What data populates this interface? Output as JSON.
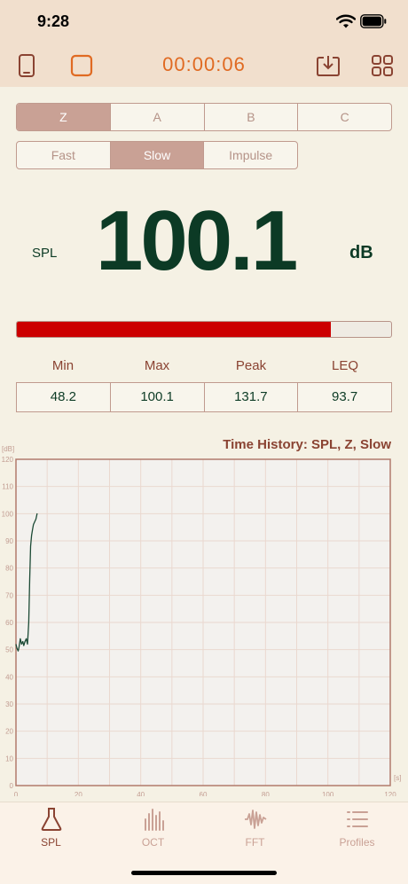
{
  "status_bar": {
    "time": "9:28"
  },
  "toolbar": {
    "timer": "00:00:06"
  },
  "weighting": {
    "options": [
      "Z",
      "A",
      "B",
      "C"
    ],
    "selected": "Z"
  },
  "response": {
    "options": [
      "Fast",
      "Slow",
      "Impulse"
    ],
    "selected": "Slow"
  },
  "readout": {
    "label": "SPL",
    "value": "100.1",
    "unit": "dB",
    "level_fraction": 0.84
  },
  "stats": {
    "labels": [
      "Min",
      "Max",
      "Peak",
      "LEQ"
    ],
    "values": [
      "48.2",
      "100.1",
      "131.7",
      "93.7"
    ]
  },
  "chart_data": {
    "type": "line",
    "title": "Time History: SPL, Z, Slow",
    "ylabel": "[dB]",
    "xlabel": "[s]",
    "xlim": [
      0,
      120
    ],
    "ylim": [
      0,
      120
    ],
    "xticks": [
      0,
      20,
      40,
      60,
      80,
      100,
      120
    ],
    "yticks": [
      0,
      10,
      20,
      30,
      40,
      50,
      60,
      70,
      80,
      90,
      100,
      110,
      120
    ],
    "grid": true,
    "series": [
      {
        "x": [
          0.0,
          0.3,
          0.7,
          1.0,
          1.4,
          1.8,
          2.2,
          2.5,
          2.9,
          3.3,
          3.7,
          4.1,
          4.4,
          4.7,
          5.0,
          5.3,
          5.6,
          6.0,
          6.4,
          6.8
        ],
        "y": [
          52,
          50.5,
          49.5,
          51,
          54,
          52,
          53,
          51.5,
          53,
          54,
          52,
          60,
          76,
          88,
          92,
          94,
          96,
          97,
          98,
          100.1
        ]
      }
    ]
  },
  "tabs": [
    {
      "label": "SPL",
      "icon": "flask-icon",
      "active": true
    },
    {
      "label": "OCT",
      "icon": "octave-bars-icon",
      "active": false
    },
    {
      "label": "FFT",
      "icon": "waveform-icon",
      "active": false
    },
    {
      "label": "Profiles",
      "icon": "list-icon",
      "active": false
    }
  ],
  "colors": {
    "accent": "#e06a22",
    "brand_dark": "#0c3a25",
    "label": "#8a4332",
    "level_fill": "#cc0000",
    "trace": "#1c4a35"
  }
}
